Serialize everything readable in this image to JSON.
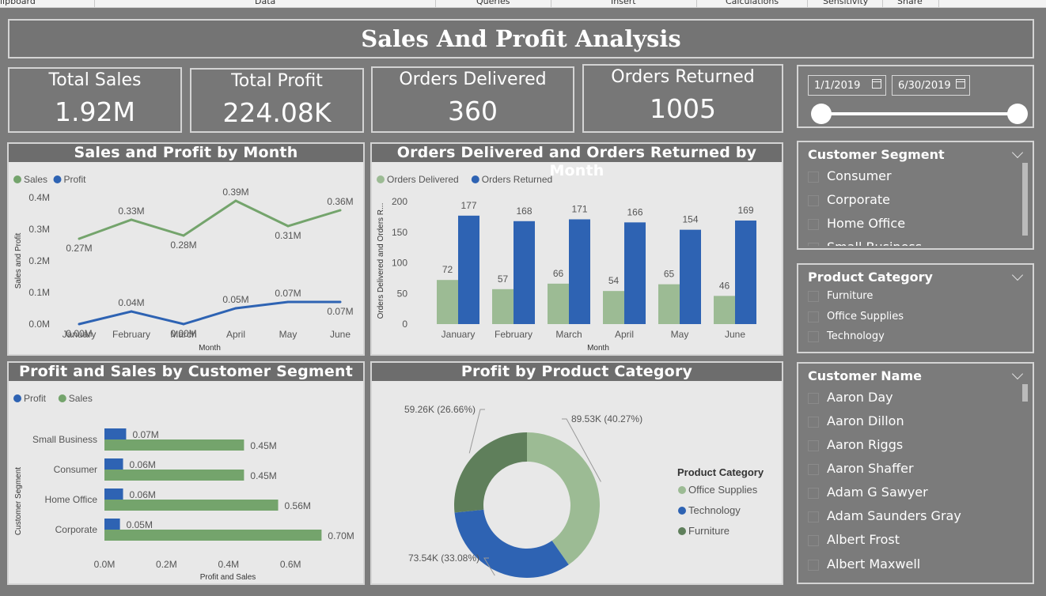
{
  "ribbon": [
    "lipboard",
    "Data",
    "Queries",
    "Insert",
    "Calculations",
    "Sensitivity",
    "Share"
  ],
  "title": "Sales And Profit Analysis",
  "kpis": [
    {
      "label": "Total Sales",
      "value": "1.92M"
    },
    {
      "label": "Total Profit",
      "value": "224.08K"
    },
    {
      "label": "Orders Delivered",
      "value": "360"
    },
    {
      "label": "Orders Returned",
      "value": "1005"
    }
  ],
  "date_range": {
    "start": "1/1/2019",
    "end": "6/30/2019"
  },
  "slicers": {
    "customer_segment": {
      "title": "Customer Segment",
      "items": [
        "Consumer",
        "Corporate",
        "Home Office",
        "Small Business"
      ]
    },
    "product_category": {
      "title": "Product Category",
      "items": [
        "Furniture",
        "Office Supplies",
        "Technology"
      ]
    },
    "customer_name": {
      "title": "Customer Name",
      "items": [
        "Aaron Day",
        "Aaron Dillon",
        "Aaron Riggs",
        "Aaron Shaffer",
        "Adam G Sawyer",
        "Adam Saunders Gray",
        "Albert Frost",
        "Albert Maxwell"
      ]
    }
  },
  "colors": {
    "sales": "#74a46c",
    "profit": "#2e63b3",
    "delivered": "#9cbb94",
    "returned": "#2e63b3",
    "furniture": "#5f7f5b",
    "office": "#9cbb94",
    "technology": "#2e63b3"
  },
  "chart_data": [
    {
      "type": "line",
      "title": "Sales and Profit by Month",
      "x": [
        "January",
        "February",
        "March",
        "April",
        "May",
        "June"
      ],
      "xlabel": "Month",
      "ylabel": "Sales and Profit",
      "yticks": [
        "0.0M",
        "0.1M",
        "0.2M",
        "0.3M",
        "0.4M"
      ],
      "ylim": [
        0,
        0.4
      ],
      "series": [
        {
          "name": "Sales",
          "values": [
            0.27,
            0.33,
            0.28,
            0.39,
            0.31,
            0.36
          ],
          "labels": [
            "0.27M",
            "0.33M",
            "0.28M",
            "0.39M",
            "0.31M",
            "0.36M"
          ]
        },
        {
          "name": "Profit",
          "values": [
            0.0,
            0.04,
            0.0,
            0.05,
            0.07,
            0.07
          ],
          "labels": [
            "0.00M",
            "0.04M",
            "0.00M",
            "0.05M",
            "0.07M",
            "0.07M"
          ]
        }
      ]
    },
    {
      "type": "bar",
      "title": "Orders Delivered and Orders Returned by Month",
      "categories": [
        "January",
        "February",
        "March",
        "April",
        "May",
        "June"
      ],
      "xlabel": "Month",
      "ylabel": "Orders Delivered and Orders R...",
      "yticks": [
        "0",
        "50",
        "100",
        "150",
        "200"
      ],
      "ylim": [
        0,
        200
      ],
      "series": [
        {
          "name": "Orders Delivered",
          "values": [
            72,
            57,
            66,
            54,
            65,
            46
          ]
        },
        {
          "name": "Orders Returned",
          "values": [
            177,
            168,
            171,
            166,
            154,
            169
          ]
        }
      ]
    },
    {
      "type": "bar",
      "orientation": "horizontal",
      "title": "Profit and Sales by Customer Segment",
      "categories": [
        "Small Business",
        "Consumer",
        "Home Office",
        "Corporate"
      ],
      "xlabel": "Profit and Sales",
      "ylabel": "Customer Segment",
      "xticks": [
        "0.0M",
        "0.2M",
        "0.4M",
        "0.6M"
      ],
      "xlim": [
        0,
        0.7
      ],
      "series": [
        {
          "name": "Profit",
          "values": [
            0.07,
            0.06,
            0.06,
            0.05
          ],
          "labels": [
            "0.07M",
            "0.06M",
            "0.06M",
            "0.05M"
          ]
        },
        {
          "name": "Sales",
          "values": [
            0.45,
            0.45,
            0.56,
            0.7
          ],
          "labels": [
            "0.45M",
            "0.45M",
            "0.56M",
            "0.70M"
          ]
        }
      ]
    },
    {
      "type": "pie",
      "title": "Profit by Product Category",
      "legend_title": "Product Category",
      "slices": [
        {
          "name": "Office Supplies",
          "value": 89.53,
          "label": "89.53K (40.27%)"
        },
        {
          "name": "Technology",
          "value": 73.54,
          "label": "73.54K (33.08%)"
        },
        {
          "name": "Furniture",
          "value": 59.26,
          "label": "59.26K (26.66%)"
        }
      ]
    }
  ]
}
